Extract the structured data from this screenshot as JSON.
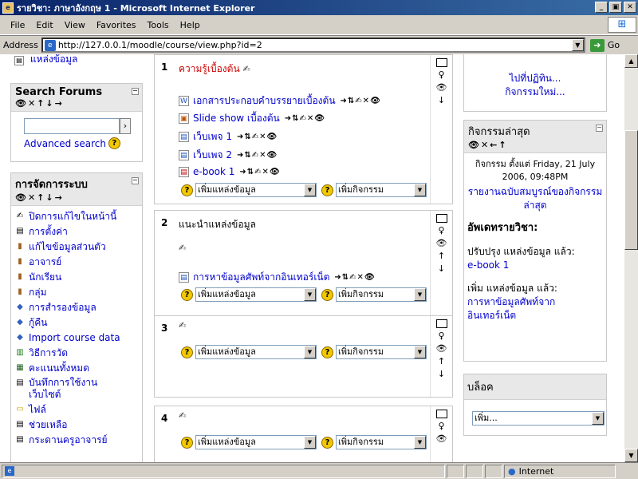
{
  "window": {
    "title": "รายวิชา: ภาษาอังกฤษ 1 - Microsoft Internet Explorer"
  },
  "menu": {
    "items": [
      "File",
      "Edit",
      "View",
      "Favorites",
      "Tools",
      "Help"
    ]
  },
  "address": {
    "label": "Address",
    "url": "http://127.0.0.1/moodle/course/view.php?id=2",
    "go": "Go"
  },
  "left": {
    "top_link": "แหล่งข้อมูล",
    "search": {
      "title": "Search Forums",
      "icons": "👁✕↑↓→",
      "advanced": "Advanced search",
      "button": "›"
    },
    "admin": {
      "title": "การจัดการระบบ",
      "icons": "👁✕↑↓→",
      "items": [
        {
          "label": "ปิดการแก้ไขในหน้านี้",
          "icon": "✍"
        },
        {
          "label": "การตั้งค่า",
          "icon": "▤"
        },
        {
          "label": "แก้ไขข้อมูลส่วนตัว",
          "icon": "▮"
        },
        {
          "label": "อาจารย์",
          "icon": "▮"
        },
        {
          "label": "นักเรียน",
          "icon": "▮"
        },
        {
          "label": "กลุ่ม",
          "icon": "▮"
        },
        {
          "label": "การสำรองข้อมูล",
          "icon": "◆"
        },
        {
          "label": "กู้คืน",
          "icon": "◆"
        },
        {
          "label": "Import course data",
          "icon": "◆"
        },
        {
          "label": "วิธีการวัด",
          "icon": "▥"
        },
        {
          "label": "คะแนนทั้งหมด",
          "icon": "▦"
        },
        {
          "label": "บันทึกการใช้งาน",
          "icon": "▤"
        },
        {
          "label": "เว็บไซต์",
          "icon": ""
        },
        {
          "label": "ไฟล์",
          "icon": "▭"
        },
        {
          "label": "ช่วยเหลือ",
          "icon": "▤"
        },
        {
          "label": "กระดานครูอาจารย์",
          "icon": "▤"
        }
      ]
    }
  },
  "center": {
    "add_resource": "เพิ่มแหล่งข้อมูล",
    "add_activity": "เพิ่มกิจกรรม",
    "edit_icons": "➜⇅✍✕👁",
    "sections": [
      {
        "num": "1",
        "title": "ความรู้เบื้องต้น",
        "resources": [
          "เอกสารประกอบคำบรรยายเบื้องต้น",
          "Slide show เบื้องต้น",
          "เว็บเพจ 1",
          "เว็บเพจ 2",
          "e-book 1"
        ]
      },
      {
        "num": "2",
        "title": "แนะนำแหล่งข้อมูล",
        "resources": [
          "การหาข้อมูลศัพท์จากอินเทอร์เน็ต"
        ]
      },
      {
        "num": "3",
        "title": "",
        "resources": []
      },
      {
        "num": "4",
        "title": "",
        "resources": []
      }
    ]
  },
  "right": {
    "goto": "ไปที่ปฏิทิน...",
    "new_event": "กิจกรรมใหม่...",
    "recent": {
      "title": "กิจกรรมล่าสุด",
      "icons": "👁✕←↑",
      "since": "กิจกรรม ตั้งแต่ Friday, 21 July 2006, 09:48PM",
      "full_report": "รายงานฉบับสมบูรณ์ของกิจกรรมล่าสุด",
      "updates_title": "อัพเดทรายวิชา:",
      "update1_label": "ปรับปรุง แหล่งข้อมูล แล้ว:",
      "update1_link": "e-book 1",
      "update2_label": "เพิ่ม แหล่งข้อมูล แล้ว:",
      "update2_link": "การหาข้อมูลศัพท์จากอินเทอร์เน็ต"
    },
    "blocks": {
      "title": "บล็อค",
      "select": "เพิ่ม..."
    }
  },
  "status": {
    "zone": "Internet"
  }
}
